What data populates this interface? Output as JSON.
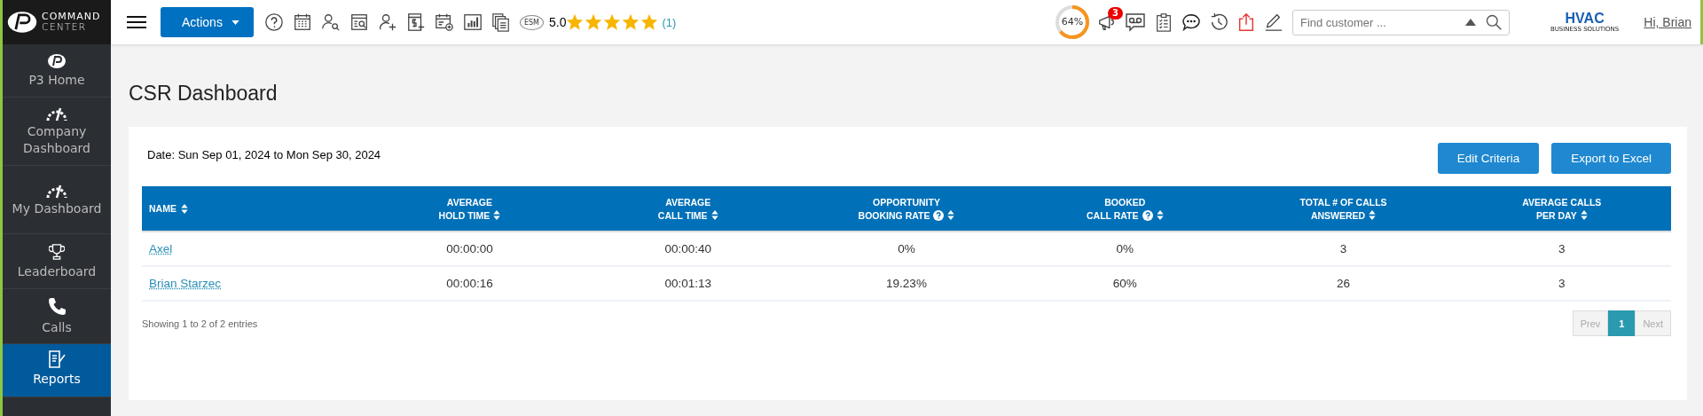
{
  "sidebar": {
    "logo": {
      "line1": "COMMAND",
      "line2": "CENTER"
    },
    "items": [
      {
        "label": "P3 Home",
        "selected": false
      },
      {
        "label": "Company Dashboard",
        "selected": false
      },
      {
        "label": "My Dashboard",
        "selected": false
      },
      {
        "label": "Leaderboard",
        "selected": false
      },
      {
        "label": "Calls",
        "selected": false
      },
      {
        "label": "Reports",
        "selected": true
      }
    ]
  },
  "topbar": {
    "actions_button": "Actions",
    "esm_label": "ESM",
    "rating": {
      "score": "5.0",
      "stars": 5,
      "count": "(1)"
    },
    "progress": {
      "label": "64%",
      "level": 0.64
    },
    "notifications_badge": "3",
    "search": {
      "placeholder": "Find customer ..."
    },
    "brand": {
      "text": "HVAC",
      "tagline": "BUSINESS SOLUTIONS"
    },
    "user_link": "Hi, Brian"
  },
  "page": {
    "title": "CSR Dashboard",
    "date": "Date:  Sun Sep 01, 2024 to Mon Sep 30, 2024",
    "buttons": [
      "Edit Criteria",
      "Export to Excel"
    ]
  },
  "table": {
    "columns": [
      {
        "line1": "NAME",
        "help": false
      },
      {
        "line1": "AVERAGE",
        "line2": "HOLD TIME",
        "help": false
      },
      {
        "line1": "AVERAGE",
        "line2": "CALL TIME",
        "help": false
      },
      {
        "line1": "OPPORTUNITY",
        "line2": "BOOKING RATE",
        "help": true
      },
      {
        "line1": "BOOKED",
        "line2": "CALL RATE",
        "help": true
      },
      {
        "line1": "TOTAL # OF CALLS",
        "line2": "ANSWERED",
        "help": false
      },
      {
        "line1": "AVERAGE CALLS",
        "line2": "PER DAY",
        "help": false
      }
    ],
    "rows": [
      [
        "Axel",
        "00:00:00",
        "00:00:40",
        "0%",
        "0%",
        "3",
        "3"
      ],
      [
        "Brian Starzec",
        "00:00:16",
        "00:01:13",
        "19.23%",
        "60%",
        "26",
        "3"
      ]
    ]
  },
  "footer": {
    "info": "Showing 1 to 2 of 2 entries",
    "pagination": [
      {
        "label": "Prev",
        "selected": false,
        "disabled": true
      },
      {
        "label": "1",
        "selected": true,
        "disabled": false
      },
      {
        "label": "Next",
        "selected": false,
        "disabled": true
      }
    ]
  }
}
